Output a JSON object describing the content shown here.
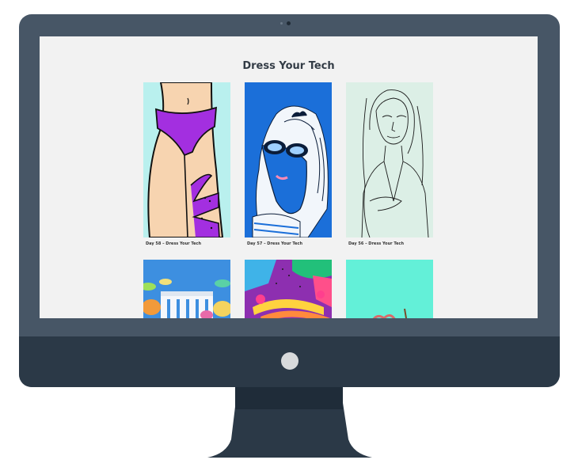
{
  "page": {
    "title": "Dress Your Tech"
  },
  "gallery": {
    "items": [
      {
        "caption": "Day 58 – Dress Your Tech",
        "bg": "#b9f0ee"
      },
      {
        "caption": "Day 57 – Dress Your Tech",
        "bg": "#1b6fd9"
      },
      {
        "caption": "Day 56 – Dress Your Tech",
        "bg": "#dcefe6"
      },
      {
        "caption": "",
        "bg": "#3d8fe0"
      },
      {
        "caption": "",
        "bg": "#8d2fb0"
      },
      {
        "caption": "",
        "bg": "#63f0d8"
      }
    ]
  },
  "colors": {
    "monitor_frame": "#475666",
    "monitor_chin": "#2b3947",
    "screen_bg": "#f2f2f2"
  }
}
